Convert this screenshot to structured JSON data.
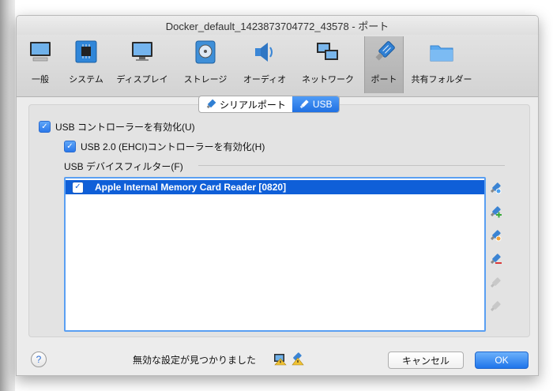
{
  "window": {
    "title": "Docker_default_1423873704772_43578 - ポート"
  },
  "toolbar": {
    "items": [
      {
        "label": "一般",
        "icon": "monitor-general-icon"
      },
      {
        "label": "システム",
        "icon": "chip-icon"
      },
      {
        "label": "ディスプレイ",
        "icon": "display-icon"
      },
      {
        "label": "ストレージ",
        "icon": "disk-icon"
      },
      {
        "label": "オーディオ",
        "icon": "speaker-icon"
      },
      {
        "label": "ネットワーク",
        "icon": "network-icon"
      },
      {
        "label": "ポート",
        "icon": "plug-icon",
        "active": true
      },
      {
        "label": "共有フォルダー",
        "icon": "folder-icon"
      }
    ]
  },
  "tabs": {
    "serial_label": "シリアルポート",
    "usb_label": "USB"
  },
  "usb": {
    "enable_controller_label": "USB コントローラーを有効化(U)",
    "enable_ehci_label": "USB 2.0 (EHCI)コントローラーを有効化(H)",
    "filters_label": "USB デバイスフィルター(F)",
    "filters": [
      {
        "label": "Apple Internal Memory Card Reader [0820]",
        "checked": true
      }
    ]
  },
  "footer": {
    "help_label": "?",
    "status_text": "無効な設定が見つかりました",
    "cancel_label": "キャンセル",
    "ok_label": "OK"
  },
  "colors": {
    "accent": "#1f70e3",
    "selection": "#0f5fd8"
  }
}
